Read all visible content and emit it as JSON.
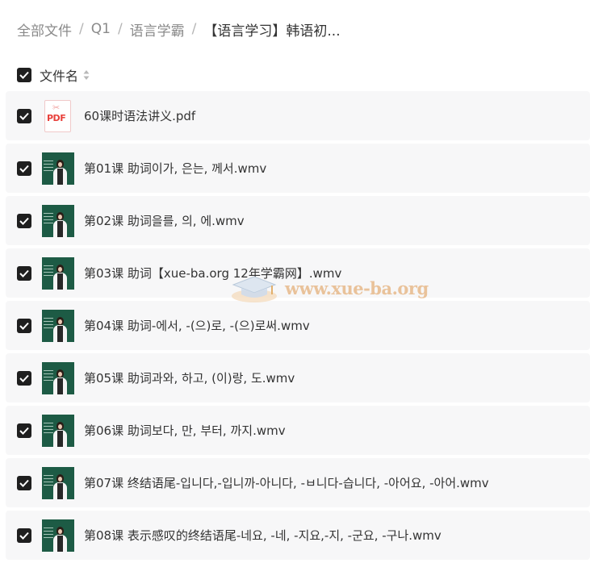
{
  "breadcrumb": {
    "items": [
      "全部文件",
      "Q1",
      "语言学霸"
    ],
    "separator": "/",
    "current": "【语言学习】韩语初..."
  },
  "header": {
    "column_label": "文件名",
    "sort_icon": "sort-icon"
  },
  "files": [
    {
      "name": "60课时语法讲义.pdf",
      "type": "pdf",
      "icon_label": "PDF"
    },
    {
      "name": "第01课 助词이가, 은는, 께서.wmv",
      "type": "video"
    },
    {
      "name": "第02课 助词을를, 의, 에.wmv",
      "type": "video"
    },
    {
      "name": "第03课 助词【xue-ba.org 12年学霸网】.wmv",
      "type": "video"
    },
    {
      "name": "第04课 助词-에서, -(으)로, -(으)로써.wmv",
      "type": "video"
    },
    {
      "name": "第05课 助词과와, 하고, (이)랑, 도.wmv",
      "type": "video"
    },
    {
      "name": "第06课 助词보다, 만, 부터, 까지.wmv",
      "type": "video"
    },
    {
      "name": "第07课 终结语尾-입니다,-입니까-아니다, -ㅂ니다-습니다, -아어요, -아어.wmv",
      "type": "video"
    },
    {
      "name": "第08课 表示感叹的终结语尾-네요, -네, -지요,-지, -군요, -구나.wmv",
      "type": "video"
    }
  ],
  "watermark": {
    "text": "www.xue-ba.org"
  },
  "colors": {
    "row_bg": "#f7f7f8",
    "checkbox": "#1f1f1f",
    "breadcrumb_muted": "#8a8a8a",
    "pdf_red": "#e8403b",
    "watermark": "#e7b98a"
  }
}
